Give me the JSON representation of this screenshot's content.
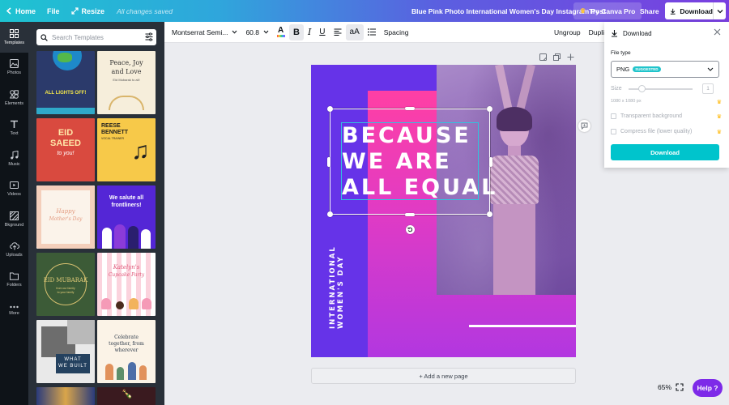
{
  "topbar": {
    "home_label": "Home",
    "file_label": "File",
    "resize_label": "Resize",
    "saved_status": "All changes saved",
    "doc_title": "Blue Pink Photo International Women's Day Instagram Post",
    "try_pro_label": "Try Canva Pro",
    "share_label": "Share",
    "download_label": "Download"
  },
  "rail": {
    "items": [
      {
        "label": "Templates",
        "icon": "templates-icon"
      },
      {
        "label": "Photos",
        "icon": "photos-icon"
      },
      {
        "label": "Elements",
        "icon": "elements-icon"
      },
      {
        "label": "Text",
        "icon": "text-icon"
      },
      {
        "label": "Music",
        "icon": "music-icon"
      },
      {
        "label": "Videos",
        "icon": "videos-icon"
      },
      {
        "label": "Bkground",
        "icon": "background-icon"
      },
      {
        "label": "Uploads",
        "icon": "uploads-icon"
      },
      {
        "label": "Folders",
        "icon": "folders-icon"
      },
      {
        "label": "More",
        "icon": "more-icon"
      }
    ]
  },
  "panel": {
    "search_placeholder": "Search Templates",
    "templates": [
      {
        "name": "lights-off",
        "lines": [
          "ALL LIGHTS OFF!"
        ]
      },
      {
        "name": "peace-joy-love",
        "lines": [
          "Peace, Joy",
          "and Love",
          "Eid Mubarak to all!"
        ]
      },
      {
        "name": "eid-saeed",
        "lines": [
          "EID",
          "SAEED",
          "to you!"
        ]
      },
      {
        "name": "reese-bennett",
        "lines": [
          "REESE",
          "BENNETT",
          "VOCAL TRAINER"
        ]
      },
      {
        "name": "happy-mothers-day",
        "lines": [
          "Happy",
          "Mother's Day"
        ]
      },
      {
        "name": "frontliners",
        "lines": [
          "We salute all",
          "frontliners!"
        ]
      },
      {
        "name": "eid-mubarak",
        "lines": [
          "EID MUBARAK",
          "from our family",
          "to your family"
        ]
      },
      {
        "name": "cupcake-party",
        "lines": [
          "Katelyn's",
          "Cupcake Party"
        ]
      },
      {
        "name": "what-we-built",
        "lines": [
          "WHAT",
          "WE BUILT"
        ]
      },
      {
        "name": "celebrate-together",
        "lines": [
          "Celebrate",
          "together, from",
          "wherever"
        ]
      }
    ]
  },
  "toolbar": {
    "font_name": "Montserrat Semi...",
    "font_size": "60.8",
    "bold": "B",
    "italic": "I",
    "underline": "U",
    "case": "aA",
    "spacing_label": "Spacing",
    "ungroup_label": "Ungroup",
    "duplicate_label": "Dupli"
  },
  "design": {
    "headline_lines": [
      "BECAUSE",
      "WE ARE",
      "ALL EQUAL"
    ],
    "vertical_lines": [
      "INTERNATIONAL",
      "WOMEN'S DAY"
    ],
    "colors": {
      "violet": "#6633e8",
      "pink": "#ff3fa4",
      "purple": "#b237e0",
      "white": "#ffffff"
    }
  },
  "canvas": {
    "add_page_label": "+ Add a new page",
    "zoom_label": "65%",
    "help_label": "Help ?"
  },
  "download_panel": {
    "title": "Download",
    "file_type_label": "File type",
    "file_type_value": "PNG",
    "suggested_badge": "SUGGESTED",
    "size_label": "Size",
    "size_value": "1",
    "dimensions": "1080 x 1080 px",
    "transparent_label": "Transparent background",
    "compress_label": "Compress file (lower quality)",
    "download_button": "Download",
    "accent": "#00c4cc"
  }
}
